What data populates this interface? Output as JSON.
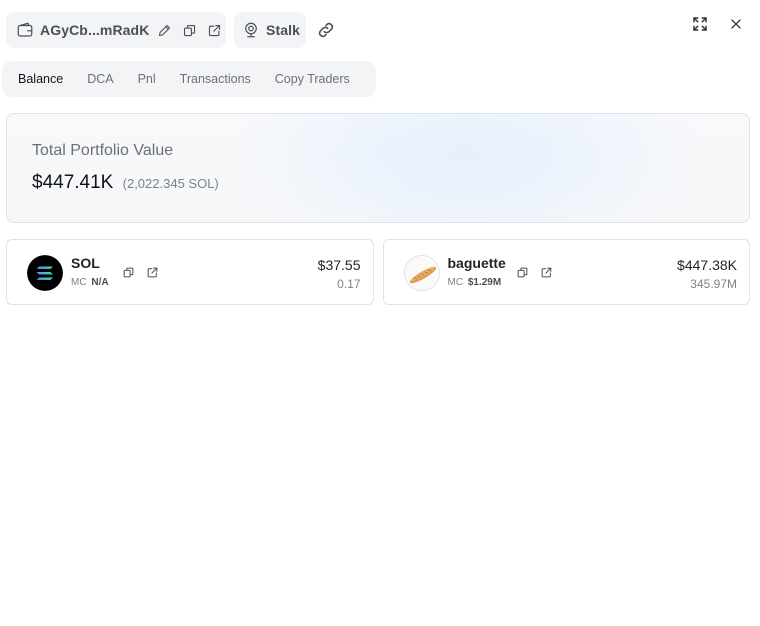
{
  "header": {
    "wallet_address": "AGyCb...mRadK",
    "stalk_label": "Stalk"
  },
  "tabs": [
    {
      "label": "Balance",
      "active": true
    },
    {
      "label": "DCA",
      "active": false
    },
    {
      "label": "Pnl",
      "active": false
    },
    {
      "label": "Transactions",
      "active": false
    },
    {
      "label": "Copy Traders",
      "active": false
    }
  ],
  "portfolio": {
    "label": "Total Portfolio Value",
    "value": "$447.41K",
    "sol_value": "(2,022.345 SOL)"
  },
  "tokens": [
    {
      "name": "SOL",
      "mc_label": "MC",
      "mc_value": "N/A",
      "usd": "$37.55",
      "amount": "0.17"
    },
    {
      "name": "baguette",
      "mc_label": "MC",
      "mc_value": "$1.29M",
      "usd": "$447.38K",
      "amount": "345.97M"
    }
  ],
  "icons": {
    "wallet": "wallet-icon",
    "edit": "pencil-icon",
    "copy": "copy-icon",
    "external": "external-link-icon",
    "stalk": "webcam-icon",
    "link": "link-icon",
    "expand": "expand-icon",
    "close": "close-icon"
  },
  "colors": {
    "accent_gradient": "#e7f0fd",
    "pill_bg": "#f3f4f6",
    "border": "#dfe2e6"
  }
}
